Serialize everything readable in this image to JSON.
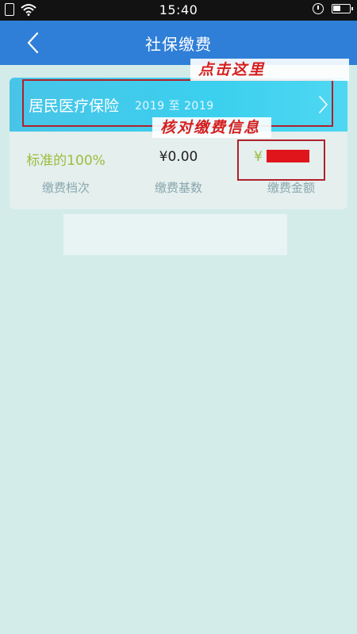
{
  "status_bar": {
    "time": "15:40",
    "icons": [
      "sim-icon",
      "wifi-icon",
      "alarm-icon",
      "battery-icon"
    ]
  },
  "header": {
    "title": "社保缴费",
    "back_icon": "chevron-left-icon"
  },
  "plan": {
    "name": "居民医疗保险",
    "period": "2019 至 2019",
    "chevron_icon": "chevron-right-icon"
  },
  "stats": [
    {
      "value": "标准的100%",
      "label": "缴费档次"
    },
    {
      "value": "¥0.00",
      "label": "缴费基数"
    },
    {
      "value": "¥",
      "label": "缴费金额"
    }
  ],
  "annotations": {
    "click_here": "点击这里",
    "verify_info": "核对缴费信息"
  },
  "colors": {
    "header": "#2f7fd8",
    "plan_gradient_start": "#48c4e8",
    "plan_gradient_end": "#4fd7f2",
    "level_text": "#9bbd3c",
    "annotation_red": "#d61f1f",
    "background": "#d3ecea"
  }
}
